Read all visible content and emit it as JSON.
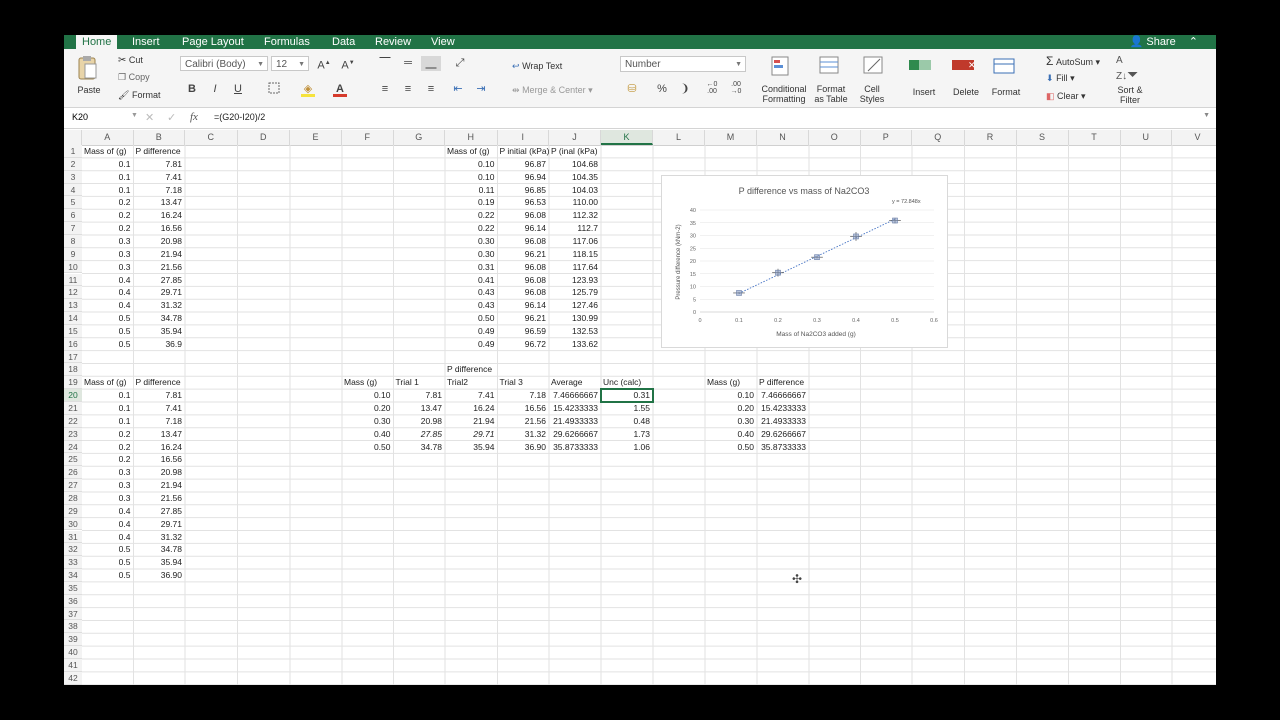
{
  "tabs": [
    "Home",
    "Insert",
    "Page Layout",
    "Formulas",
    "Data",
    "Review",
    "View"
  ],
  "share_label": "Share",
  "ribbon": {
    "paste": "Paste",
    "cut": "Cut",
    "copy": "Copy",
    "format": "Format",
    "font_name": "Calibri (Body)",
    "font_size": "12",
    "bold": "B",
    "italic": "I",
    "underline": "U",
    "wrap_text": "Wrap Text",
    "merge_center": "Merge & Center",
    "number_format": "Number",
    "percent": "%",
    "comma": "❩",
    "conditional_formatting": [
      "Conditional",
      "Formatting"
    ],
    "format_as_table": [
      "Format",
      "as Table"
    ],
    "cell_styles": [
      "Cell",
      "Styles"
    ],
    "insert": "Insert",
    "delete": "Delete",
    "format_cells": "Format",
    "autosum": "AutoSum",
    "fill": "Fill",
    "clear": "Clear",
    "sort_filter": [
      "Sort &",
      "Filter"
    ]
  },
  "formula_bar": {
    "name_box": "K20",
    "fx": "fx",
    "formula": "=(G20-I20)/2"
  },
  "columns": [
    "A",
    "B",
    "C",
    "D",
    "E",
    "F",
    "G",
    "H",
    "I",
    "J",
    "K",
    "L",
    "M",
    "N",
    "O",
    "P",
    "Q",
    "R",
    "S",
    "T",
    "U",
    "V"
  ],
  "selected_column": "K",
  "selected_row": 20,
  "row_count": 42,
  "cells": [
    {
      "c": "A",
      "r": 1,
      "v": "Mass of (g)"
    },
    {
      "c": "B",
      "r": 1,
      "v": "P difference"
    },
    {
      "c": "A",
      "r": 2,
      "v": "0.1",
      "n": 1
    },
    {
      "c": "B",
      "r": 2,
      "v": "7.81",
      "n": 1
    },
    {
      "c": "A",
      "r": 3,
      "v": "0.1",
      "n": 1
    },
    {
      "c": "B",
      "r": 3,
      "v": "7.41",
      "n": 1
    },
    {
      "c": "A",
      "r": 4,
      "v": "0.1",
      "n": 1
    },
    {
      "c": "B",
      "r": 4,
      "v": "7.18",
      "n": 1
    },
    {
      "c": "A",
      "r": 5,
      "v": "0.2",
      "n": 1
    },
    {
      "c": "B",
      "r": 5,
      "v": "13.47",
      "n": 1
    },
    {
      "c": "A",
      "r": 6,
      "v": "0.2",
      "n": 1
    },
    {
      "c": "B",
      "r": 6,
      "v": "16.24",
      "n": 1
    },
    {
      "c": "A",
      "r": 7,
      "v": "0.2",
      "n": 1
    },
    {
      "c": "B",
      "r": 7,
      "v": "16.56",
      "n": 1
    },
    {
      "c": "A",
      "r": 8,
      "v": "0.3",
      "n": 1
    },
    {
      "c": "B",
      "r": 8,
      "v": "20.98",
      "n": 1
    },
    {
      "c": "A",
      "r": 9,
      "v": "0.3",
      "n": 1
    },
    {
      "c": "B",
      "r": 9,
      "v": "21.94",
      "n": 1
    },
    {
      "c": "A",
      "r": 10,
      "v": "0.3",
      "n": 1
    },
    {
      "c": "B",
      "r": 10,
      "v": "21.56",
      "n": 1
    },
    {
      "c": "A",
      "r": 11,
      "v": "0.4",
      "n": 1
    },
    {
      "c": "B",
      "r": 11,
      "v": "27.85",
      "n": 1
    },
    {
      "c": "A",
      "r": 12,
      "v": "0.4",
      "n": 1
    },
    {
      "c": "B",
      "r": 12,
      "v": "29.71",
      "n": 1
    },
    {
      "c": "A",
      "r": 13,
      "v": "0.4",
      "n": 1
    },
    {
      "c": "B",
      "r": 13,
      "v": "31.32",
      "n": 1
    },
    {
      "c": "A",
      "r": 14,
      "v": "0.5",
      "n": 1
    },
    {
      "c": "B",
      "r": 14,
      "v": "34.78",
      "n": 1
    },
    {
      "c": "A",
      "r": 15,
      "v": "0.5",
      "n": 1
    },
    {
      "c": "B",
      "r": 15,
      "v": "35.94",
      "n": 1
    },
    {
      "c": "A",
      "r": 16,
      "v": "0.5",
      "n": 1
    },
    {
      "c": "B",
      "r": 16,
      "v": "36.9",
      "n": 1
    },
    {
      "c": "H",
      "r": 1,
      "v": "Mass of (g)"
    },
    {
      "c": "I",
      "r": 1,
      "v": "P initial (kPa)"
    },
    {
      "c": "J",
      "r": 1,
      "v": "P (inal (kPa)"
    },
    {
      "c": "H",
      "r": 2,
      "v": "0.10",
      "n": 1
    },
    {
      "c": "I",
      "r": 2,
      "v": "96.87",
      "n": 1
    },
    {
      "c": "J",
      "r": 2,
      "v": "104.68",
      "n": 1
    },
    {
      "c": "H",
      "r": 3,
      "v": "0.10",
      "n": 1
    },
    {
      "c": "I",
      "r": 3,
      "v": "96.94",
      "n": 1
    },
    {
      "c": "J",
      "r": 3,
      "v": "104.35",
      "n": 1
    },
    {
      "c": "H",
      "r": 4,
      "v": "0.11",
      "n": 1
    },
    {
      "c": "I",
      "r": 4,
      "v": "96.85",
      "n": 1
    },
    {
      "c": "J",
      "r": 4,
      "v": "104.03",
      "n": 1
    },
    {
      "c": "H",
      "r": 5,
      "v": "0.19",
      "n": 1
    },
    {
      "c": "I",
      "r": 5,
      "v": "96.53",
      "n": 1
    },
    {
      "c": "J",
      "r": 5,
      "v": "110.00",
      "n": 1
    },
    {
      "c": "H",
      "r": 6,
      "v": "0.22",
      "n": 1
    },
    {
      "c": "I",
      "r": 6,
      "v": "96.08",
      "n": 1
    },
    {
      "c": "J",
      "r": 6,
      "v": "112.32",
      "n": 1
    },
    {
      "c": "H",
      "r": 7,
      "v": "0.22",
      "n": 1
    },
    {
      "c": "I",
      "r": 7,
      "v": "96.14",
      "n": 1
    },
    {
      "c": "J",
      "r": 7,
      "v": "112.7",
      "n": 1
    },
    {
      "c": "H",
      "r": 8,
      "v": "0.30",
      "n": 1
    },
    {
      "c": "I",
      "r": 8,
      "v": "96.08",
      "n": 1
    },
    {
      "c": "J",
      "r": 8,
      "v": "117.06",
      "n": 1
    },
    {
      "c": "H",
      "r": 9,
      "v": "0.30",
      "n": 1
    },
    {
      "c": "I",
      "r": 9,
      "v": "96.21",
      "n": 1
    },
    {
      "c": "J",
      "r": 9,
      "v": "118.15",
      "n": 1
    },
    {
      "c": "H",
      "r": 10,
      "v": "0.31",
      "n": 1
    },
    {
      "c": "I",
      "r": 10,
      "v": "96.08",
      "n": 1
    },
    {
      "c": "J",
      "r": 10,
      "v": "117.64",
      "n": 1
    },
    {
      "c": "H",
      "r": 11,
      "v": "0.41",
      "n": 1
    },
    {
      "c": "I",
      "r": 11,
      "v": "96.08",
      "n": 1
    },
    {
      "c": "J",
      "r": 11,
      "v": "123.93",
      "n": 1
    },
    {
      "c": "H",
      "r": 12,
      "v": "0.43",
      "n": 1
    },
    {
      "c": "I",
      "r": 12,
      "v": "96.08",
      "n": 1
    },
    {
      "c": "J",
      "r": 12,
      "v": "125.79",
      "n": 1
    },
    {
      "c": "H",
      "r": 13,
      "v": "0.43",
      "n": 1
    },
    {
      "c": "I",
      "r": 13,
      "v": "96.14",
      "n": 1
    },
    {
      "c": "J",
      "r": 13,
      "v": "127.46",
      "n": 1
    },
    {
      "c": "H",
      "r": 14,
      "v": "0.50",
      "n": 1
    },
    {
      "c": "I",
      "r": 14,
      "v": "96.21",
      "n": 1
    },
    {
      "c": "J",
      "r": 14,
      "v": "130.99",
      "n": 1
    },
    {
      "c": "H",
      "r": 15,
      "v": "0.49",
      "n": 1
    },
    {
      "c": "I",
      "r": 15,
      "v": "96.59",
      "n": 1
    },
    {
      "c": "J",
      "r": 15,
      "v": "132.53",
      "n": 1
    },
    {
      "c": "H",
      "r": 16,
      "v": "0.49",
      "n": 1
    },
    {
      "c": "I",
      "r": 16,
      "v": "96.72",
      "n": 1
    },
    {
      "c": "J",
      "r": 16,
      "v": "133.62",
      "n": 1
    },
    {
      "c": "H",
      "r": 18,
      "v": "P difference"
    },
    {
      "c": "F",
      "r": 19,
      "v": "Mass (g)"
    },
    {
      "c": "G",
      "r": 19,
      "v": "Trial 1"
    },
    {
      "c": "H",
      "r": 19,
      "v": "Trial2"
    },
    {
      "c": "I",
      "r": 19,
      "v": "Trial 3"
    },
    {
      "c": "J",
      "r": 19,
      "v": "Average"
    },
    {
      "c": "K",
      "r": 19,
      "v": "Unc (calc)"
    },
    {
      "c": "F",
      "r": 20,
      "v": "0.10",
      "n": 1
    },
    {
      "c": "G",
      "r": 20,
      "v": "7.81",
      "n": 1
    },
    {
      "c": "H",
      "r": 20,
      "v": "7.41",
      "n": 1
    },
    {
      "c": "I",
      "r": 20,
      "v": "7.18",
      "n": 1
    },
    {
      "c": "J",
      "r": 20,
      "v": "7.46666667",
      "n": 1
    },
    {
      "c": "K",
      "r": 20,
      "v": "0.31",
      "n": 1
    },
    {
      "c": "F",
      "r": 21,
      "v": "0.20",
      "n": 1
    },
    {
      "c": "G",
      "r": 21,
      "v": "13.47",
      "n": 1
    },
    {
      "c": "H",
      "r": 21,
      "v": "16.24",
      "n": 1
    },
    {
      "c": "I",
      "r": 21,
      "v": "16.56",
      "n": 1
    },
    {
      "c": "J",
      "r": 21,
      "v": "15.4233333",
      "n": 1
    },
    {
      "c": "K",
      "r": 21,
      "v": "1.55",
      "n": 1
    },
    {
      "c": "F",
      "r": 22,
      "v": "0.30",
      "n": 1
    },
    {
      "c": "G",
      "r": 22,
      "v": "20.98",
      "n": 1
    },
    {
      "c": "H",
      "r": 22,
      "v": "21.94",
      "n": 1
    },
    {
      "c": "I",
      "r": 22,
      "v": "21.56",
      "n": 1
    },
    {
      "c": "J",
      "r": 22,
      "v": "21.4933333",
      "n": 1
    },
    {
      "c": "K",
      "r": 22,
      "v": "0.48",
      "n": 1
    },
    {
      "c": "F",
      "r": 23,
      "v": "0.40",
      "n": 1
    },
    {
      "c": "G",
      "r": 23,
      "v": "27.85",
      "n": 1,
      "i": 1
    },
    {
      "c": "H",
      "r": 23,
      "v": "29.71",
      "n": 1,
      "i": 1
    },
    {
      "c": "I",
      "r": 23,
      "v": "31.32",
      "n": 1
    },
    {
      "c": "J",
      "r": 23,
      "v": "29.6266667",
      "n": 1
    },
    {
      "c": "K",
      "r": 23,
      "v": "1.73",
      "n": 1
    },
    {
      "c": "F",
      "r": 24,
      "v": "0.50",
      "n": 1
    },
    {
      "c": "G",
      "r": 24,
      "v": "34.78",
      "n": 1
    },
    {
      "c": "H",
      "r": 24,
      "v": "35.94",
      "n": 1
    },
    {
      "c": "I",
      "r": 24,
      "v": "36.90",
      "n": 1
    },
    {
      "c": "J",
      "r": 24,
      "v": "35.8733333",
      "n": 1
    },
    {
      "c": "K",
      "r": 24,
      "v": "1.06",
      "n": 1
    },
    {
      "c": "M",
      "r": 19,
      "v": "Mass (g)"
    },
    {
      "c": "N",
      "r": 19,
      "v": "P difference"
    },
    {
      "c": "M",
      "r": 20,
      "v": "0.10",
      "n": 1
    },
    {
      "c": "N",
      "r": 20,
      "v": "7.46666667",
      "n": 1
    },
    {
      "c": "M",
      "r": 21,
      "v": "0.20",
      "n": 1
    },
    {
      "c": "N",
      "r": 21,
      "v": "15.4233333",
      "n": 1
    },
    {
      "c": "M",
      "r": 22,
      "v": "0.30",
      "n": 1
    },
    {
      "c": "N",
      "r": 22,
      "v": "21.4933333",
      "n": 1
    },
    {
      "c": "M",
      "r": 23,
      "v": "0.40",
      "n": 1
    },
    {
      "c": "N",
      "r": 23,
      "v": "29.6266667",
      "n": 1
    },
    {
      "c": "M",
      "r": 24,
      "v": "0.50",
      "n": 1
    },
    {
      "c": "N",
      "r": 24,
      "v": "35.8733333",
      "n": 1
    },
    {
      "c": "A",
      "r": 19,
      "v": "Mass of (g)"
    },
    {
      "c": "B",
      "r": 19,
      "v": "P difference"
    },
    {
      "c": "A",
      "r": 20,
      "v": "0.1",
      "n": 1
    },
    {
      "c": "B",
      "r": 20,
      "v": "7.81",
      "n": 1
    },
    {
      "c": "A",
      "r": 21,
      "v": "0.1",
      "n": 1
    },
    {
      "c": "B",
      "r": 21,
      "v": "7.41",
      "n": 1
    },
    {
      "c": "A",
      "r": 22,
      "v": "0.1",
      "n": 1
    },
    {
      "c": "B",
      "r": 22,
      "v": "7.18",
      "n": 1
    },
    {
      "c": "A",
      "r": 23,
      "v": "0.2",
      "n": 1
    },
    {
      "c": "B",
      "r": 23,
      "v": "13.47",
      "n": 1
    },
    {
      "c": "A",
      "r": 24,
      "v": "0.2",
      "n": 1
    },
    {
      "c": "B",
      "r": 24,
      "v": "16.24",
      "n": 1
    },
    {
      "c": "A",
      "r": 25,
      "v": "0.2",
      "n": 1
    },
    {
      "c": "B",
      "r": 25,
      "v": "16.56",
      "n": 1
    },
    {
      "c": "A",
      "r": 26,
      "v": "0.3",
      "n": 1
    },
    {
      "c": "B",
      "r": 26,
      "v": "20.98",
      "n": 1
    },
    {
      "c": "A",
      "r": 27,
      "v": "0.3",
      "n": 1
    },
    {
      "c": "B",
      "r": 27,
      "v": "21.94",
      "n": 1
    },
    {
      "c": "A",
      "r": 28,
      "v": "0.3",
      "n": 1
    },
    {
      "c": "B",
      "r": 28,
      "v": "21.56",
      "n": 1
    },
    {
      "c": "A",
      "r": 29,
      "v": "0.4",
      "n": 1
    },
    {
      "c": "B",
      "r": 29,
      "v": "27.85",
      "n": 1
    },
    {
      "c": "A",
      "r": 30,
      "v": "0.4",
      "n": 1
    },
    {
      "c": "B",
      "r": 30,
      "v": "29.71",
      "n": 1
    },
    {
      "c": "A",
      "r": 31,
      "v": "0.4",
      "n": 1
    },
    {
      "c": "B",
      "r": 31,
      "v": "31.32",
      "n": 1
    },
    {
      "c": "A",
      "r": 32,
      "v": "0.5",
      "n": 1
    },
    {
      "c": "B",
      "r": 32,
      "v": "34.78",
      "n": 1
    },
    {
      "c": "A",
      "r": 33,
      "v": "0.5",
      "n": 1
    },
    {
      "c": "B",
      "r": 33,
      "v": "35.94",
      "n": 1
    },
    {
      "c": "A",
      "r": 34,
      "v": "0.5",
      "n": 1
    },
    {
      "c": "B",
      "r": 34,
      "v": "36.90",
      "n": 1
    }
  ],
  "chart_data": {
    "type": "scatter",
    "title": "P difference vs mass of Na2CO3",
    "xlabel": "Mass of Na2CO3 added (g)",
    "ylabel": "Pressure difference (kNm-2)",
    "trendline_label": "y = 72.848x",
    "trendline_slope": 72.848,
    "xlim": [
      0,
      0.6
    ],
    "ylim": [
      0,
      40
    ],
    "xticks": [
      "0",
      "0.1",
      "0.2",
      "0.3",
      "0.4",
      "0.5",
      "0.6"
    ],
    "yticks": [
      "0",
      "5",
      "10",
      "15",
      "20",
      "25",
      "30",
      "35",
      "40"
    ],
    "grid": true,
    "x": [
      0.1,
      0.2,
      0.3,
      0.4,
      0.5
    ],
    "y": [
      7.47,
      15.42,
      21.49,
      29.63,
      35.87
    ],
    "errors": [
      0.31,
      1.55,
      0.48,
      1.73,
      1.06
    ],
    "marker_color": "#8096c0",
    "line_color": "#4472c4"
  },
  "colors": {
    "accent": "#217346",
    "selection": "#217346"
  }
}
